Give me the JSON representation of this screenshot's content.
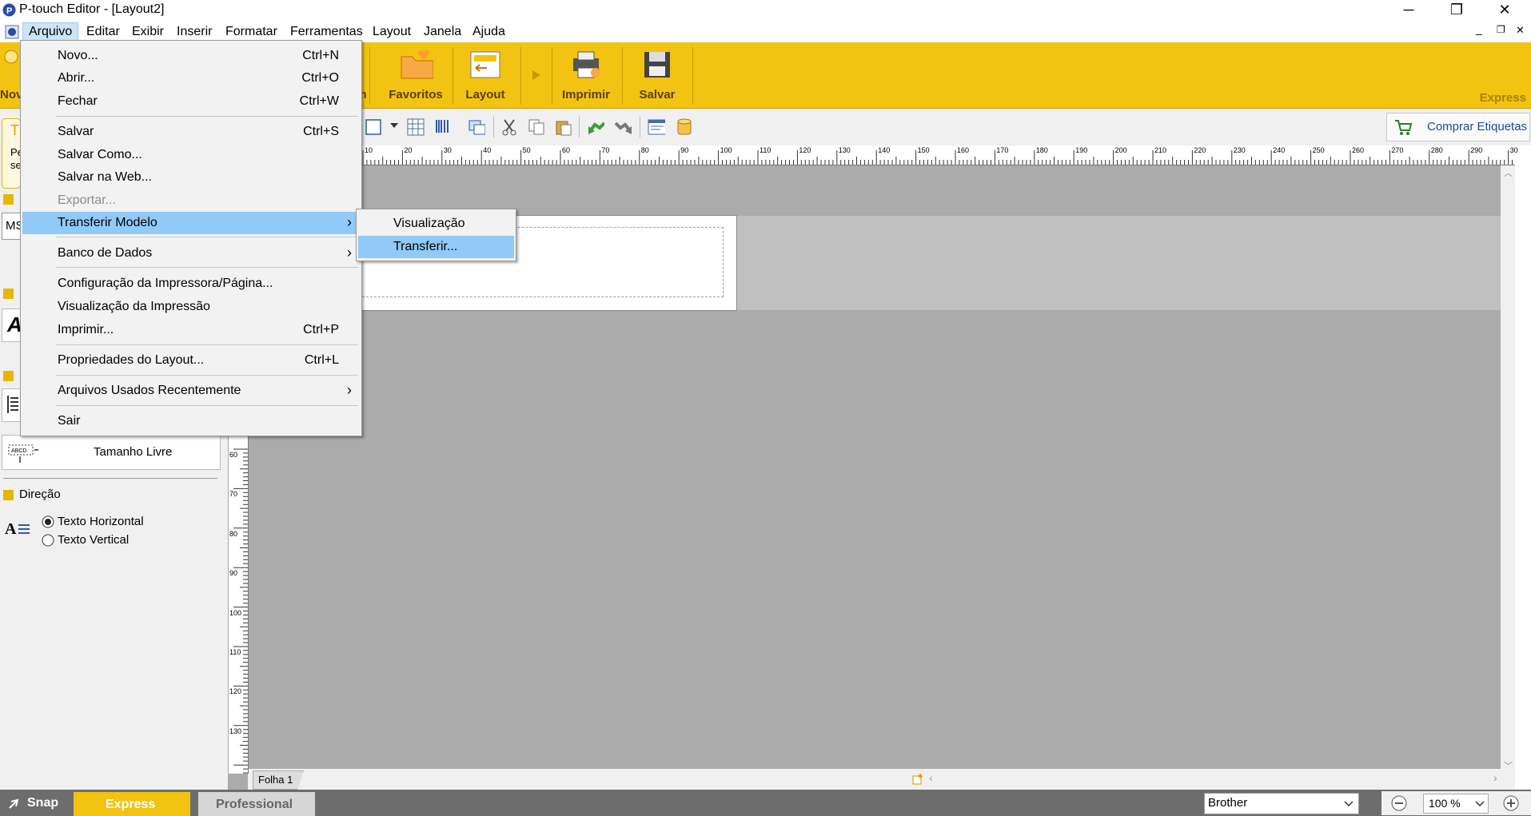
{
  "window": {
    "title": "P-touch Editor - [Layout2]",
    "controls": {
      "minimize": "─",
      "restore": "❐",
      "close": "✕"
    },
    "mdi_controls": {
      "minimize": "_",
      "restore": "❐",
      "close": "✕"
    }
  },
  "menubar": {
    "items": [
      "Arquivo",
      "Editar",
      "Exibir",
      "Inserir",
      "Formatar",
      "Ferramentas",
      "Layout",
      "Janela",
      "Ajuda"
    ],
    "active": "Arquivo"
  },
  "ribbon": {
    "partial_left_label": "Nov",
    "partial_label": "m",
    "buttons": [
      "Favoritos",
      "Layout",
      "Imprimir",
      "Salvar"
    ],
    "mode_label": "Express"
  },
  "toolbar": {
    "buy_labels": "Comprar Etiquetas"
  },
  "left_panel": {
    "tip_char": "T",
    "tip_text_1": "Pe",
    "tip_text_2": "se",
    "font_field": "MS",
    "text_sample": "A",
    "free_size_label": "Tamanho Livre",
    "free_size_icon_text": "ABCD",
    "direction_heading": "Direção",
    "direction_options": [
      "Texto Horizontal",
      "Texto Vertical"
    ],
    "direction_selected": "Texto Horizontal"
  },
  "rulers": {
    "h_labels": [
      "10",
      "20",
      "30",
      "40",
      "50",
      "60",
      "70",
      "80",
      "90",
      "100",
      "110",
      "120",
      "130",
      "140",
      "150",
      "160",
      "170",
      "180",
      "190",
      "200",
      "210",
      "220",
      "230",
      "240",
      "250",
      "260",
      "270",
      "280",
      "290",
      "30"
    ],
    "v_labels": [
      "60",
      "70",
      "80",
      "90",
      "100",
      "110",
      "120",
      "130"
    ]
  },
  "sheet_tab": "Folha 1",
  "statusbar": {
    "snap": "Snap",
    "express": "Express",
    "professional": "Professional",
    "printer": "Brother",
    "zoom": "100 %"
  },
  "file_menu": {
    "items": [
      {
        "label": "Novo...",
        "shortcut": "Ctrl+N"
      },
      {
        "label": "Abrir...",
        "shortcut": "Ctrl+O"
      },
      {
        "label": "Fechar",
        "shortcut": "Ctrl+W"
      },
      {
        "label": "Salvar",
        "shortcut": "Ctrl+S"
      },
      {
        "label": "Salvar Como...",
        "shortcut": ""
      },
      {
        "label": "Salvar na Web...",
        "shortcut": ""
      },
      {
        "label": "Exportar...",
        "shortcut": "",
        "disabled": true
      },
      {
        "label": "Transferir Modelo",
        "shortcut": "",
        "submenu": true,
        "highlighted": true
      },
      {
        "label": "Banco de Dados",
        "shortcut": "",
        "submenu": true
      },
      {
        "label": "Configuração da Impressora/Página...",
        "shortcut": ""
      },
      {
        "label": "Visualização da Impressão",
        "shortcut": ""
      },
      {
        "label": "Imprimir...",
        "shortcut": "Ctrl+P"
      },
      {
        "label": "Propriedades do Layout...",
        "shortcut": "Ctrl+L"
      },
      {
        "label": "Arquivos Usados Recentemente",
        "shortcut": "",
        "submenu": true
      },
      {
        "label": "Sair",
        "shortcut": ""
      }
    ],
    "submenu_arrow": "›"
  },
  "transfer_submenu": {
    "items": [
      {
        "label": "Visualização"
      },
      {
        "label": "Transferir...",
        "highlighted": true
      }
    ]
  },
  "colors": {
    "ribbon": "#f2c311",
    "menu_highlight": "#91c9f7",
    "canvas": "#ababab",
    "statusbar": "#6d6d6d"
  }
}
